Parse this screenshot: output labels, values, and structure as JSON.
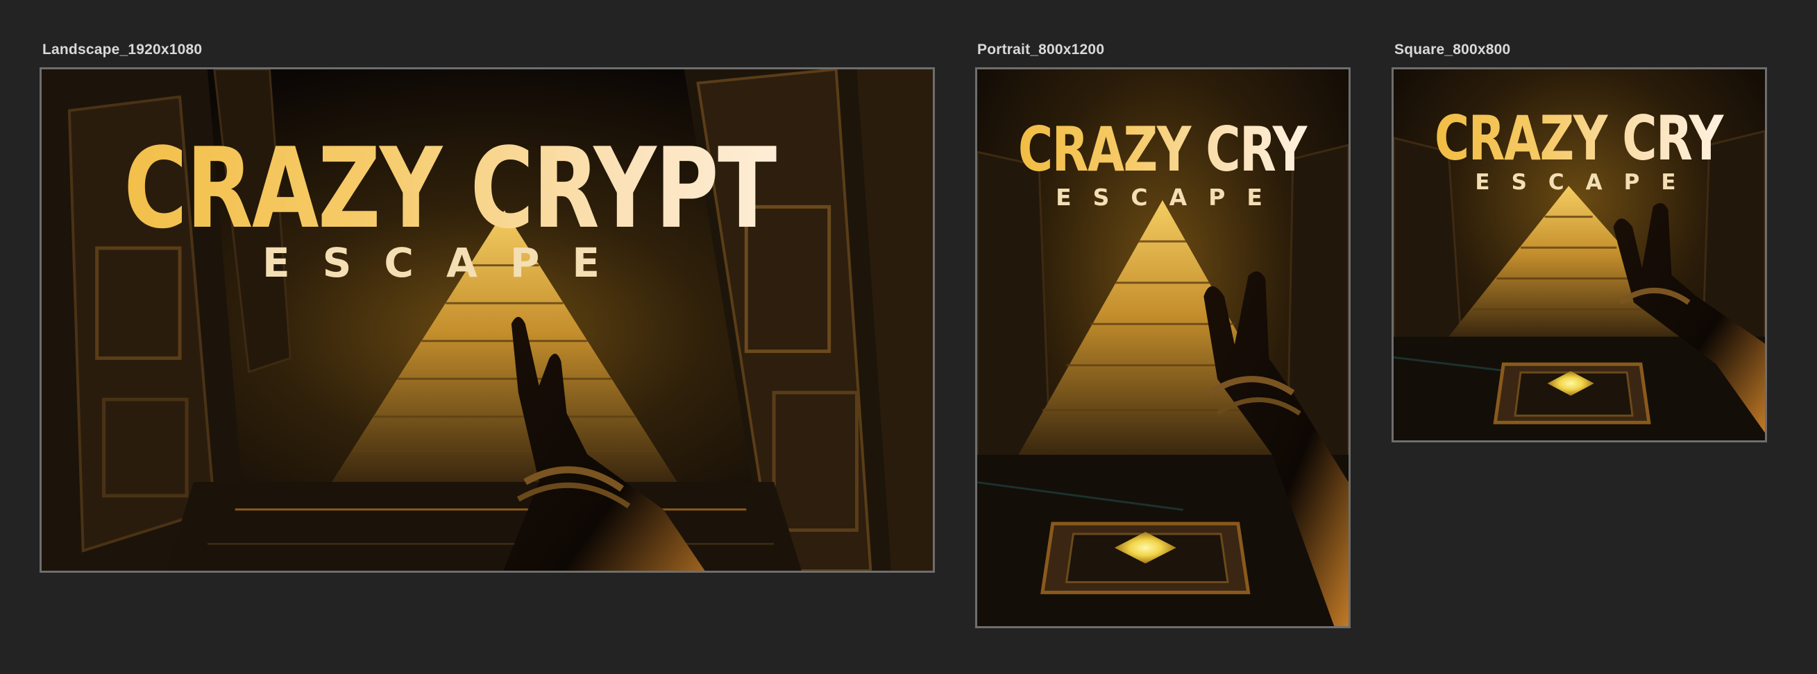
{
  "artboards": [
    {
      "label": "Landscape_1920x1080",
      "title": "CRAZY CRYPT",
      "subtitle": "ESCAPE"
    },
    {
      "label": "Portrait_800x1200",
      "title": "CRAZY CRYPT",
      "subtitle": "ESCAPE"
    },
    {
      "label": "Square_800x800",
      "title": "CRAZY CRYPT",
      "subtitle": "ESCAPE"
    }
  ],
  "colors": {
    "workspace_background": "#232323",
    "frame_border": "#6e6e6e",
    "label_text": "#d9d9d9",
    "title_gold": "#f1bd43",
    "title_cream": "#fff1e0",
    "pyramid_glow": "#e0a630"
  }
}
